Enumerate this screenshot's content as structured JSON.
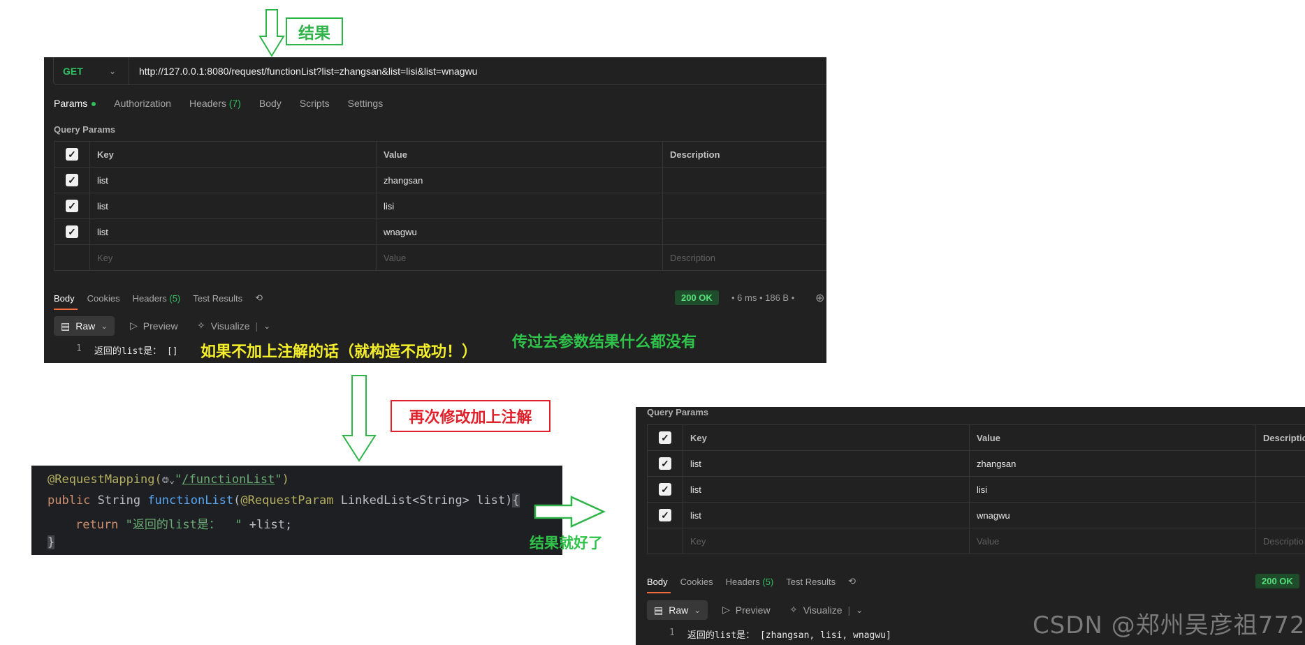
{
  "top_panel": {
    "request": {
      "method": "GET",
      "url": "http://127.0.0.1:8080/request/functionList?list=zhangsan&list=lisi&list=wnagwu"
    },
    "tabs": [
      "Params",
      "Authorization",
      "Headers",
      "Body",
      "Scripts",
      "Settings"
    ],
    "headers_count": "(7)",
    "query_params_label": "Query Params",
    "table": {
      "columns": [
        "Key",
        "Value",
        "Description"
      ],
      "rows": [
        {
          "key": "list",
          "value": "zhangsan"
        },
        {
          "key": "list",
          "value": "lisi"
        },
        {
          "key": "list",
          "value": "wnagwu"
        }
      ],
      "placeholder": {
        "key": "Key",
        "value": "Value",
        "description": "Description"
      }
    },
    "response_tabs": [
      "Body",
      "Cookies",
      "Headers",
      "Test Results"
    ],
    "response_headers_count": "(5)",
    "status": "200 OK",
    "time": "6 ms",
    "size": "186 B",
    "toolbar": {
      "raw": "Raw",
      "preview": "Preview",
      "visualize": "Visualize"
    },
    "response": {
      "line_no": "1",
      "text": "返回的list是： []"
    }
  },
  "annotations": {
    "result_box": "结果",
    "yellow_note": "如果不加上注解的话（就构造不成功！）",
    "green_note": "传过去参数结果什么都没有",
    "red_box": "再次修改加上注解",
    "result_good": "结果就好了"
  },
  "code": {
    "line1_ann": "@RequestMapping(",
    "line1_icon": "🌐︎⌄",
    "line1_path": "/functionList",
    "line1_end": ")",
    "line2_kw": "public",
    "line2_type": " String ",
    "line2_fn": "functionList",
    "line2_paren": "(",
    "line2_ann": "@RequestParam",
    "line2_rest": " LinkedList<String> list)",
    "line2_brace": "{",
    "line3_kw": "return",
    "line3_str": " \"返回的list是：  \"",
    "line3_rest": " +list;",
    "line4": "}"
  },
  "right_panel": {
    "query_params_label": "Query Params",
    "table": {
      "columns": [
        "Key",
        "Value",
        "Descriptio"
      ],
      "rows": [
        {
          "key": "list",
          "value": "zhangsan"
        },
        {
          "key": "list",
          "value": "lisi"
        },
        {
          "key": "list",
          "value": "wnagwu"
        }
      ],
      "placeholder": {
        "key": "Key",
        "value": "Value",
        "description": "Descriptio"
      }
    },
    "response_tabs": [
      "Body",
      "Cookies",
      "Headers",
      "Test Results"
    ],
    "response_headers_count": "(5)",
    "status": "200 OK",
    "toolbar": {
      "raw": "Raw",
      "preview": "Preview",
      "visualize": "Visualize"
    },
    "response": {
      "line_no": "1",
      "text": "返回的list是： [zhangsan, lisi, wnagwu]"
    }
  },
  "watermark": "CSDN @郑州吴彦祖772",
  "colors": {
    "accent_green": "#30c060",
    "status_bg": "#1f4d2b",
    "annotation_yellow": "#f5ef2a",
    "annotation_red": "#e0202a"
  }
}
